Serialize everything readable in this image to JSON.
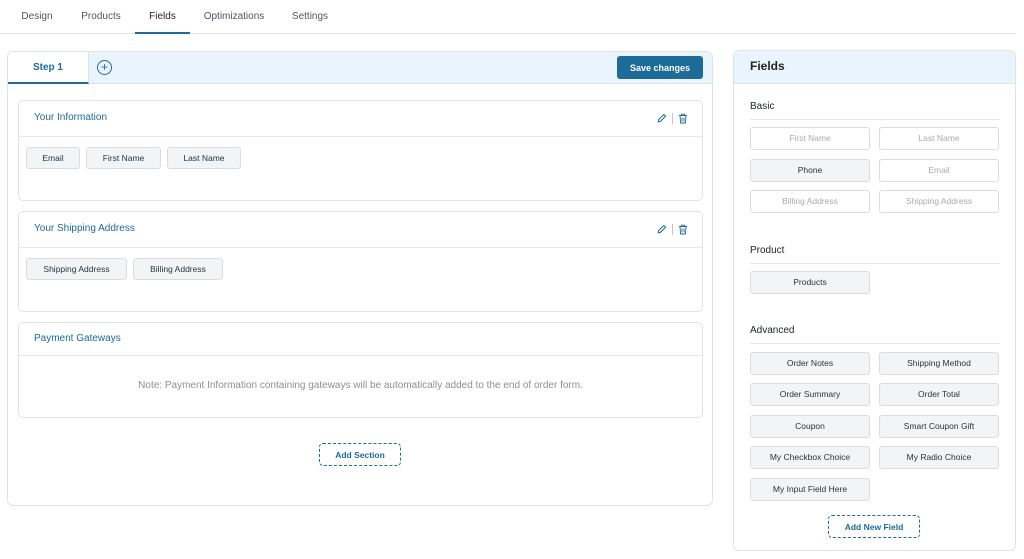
{
  "top_tabs": [
    {
      "label": "Design"
    },
    {
      "label": "Products"
    },
    {
      "label": "Fields",
      "active": true
    },
    {
      "label": "Optimizations"
    },
    {
      "label": "Settings"
    }
  ],
  "steps": {
    "current": "Step 1",
    "add_glyph": "+",
    "save_label": "Save changes"
  },
  "sections": [
    {
      "title": "Your Information",
      "fields": [
        "Email",
        "First Name",
        "Last Name"
      ]
    },
    {
      "title": "Your Shipping Address",
      "fields": [
        "Shipping Address",
        "Billing Address"
      ]
    },
    {
      "title": "Payment Gateways",
      "note": "Note: Payment Information containing gateways will be automatically added to the end of order form."
    }
  ],
  "add_section_label": "Add Section",
  "fields_panel": {
    "title": "Fields",
    "groups": [
      {
        "title": "Basic",
        "items": [
          {
            "label": "First Name",
            "enabled": false
          },
          {
            "label": "Last Name",
            "enabled": false
          },
          {
            "label": "Phone",
            "enabled": true
          },
          {
            "label": "Email",
            "enabled": false
          },
          {
            "label": "Billing Address",
            "enabled": false
          },
          {
            "label": "Shipping Address",
            "enabled": false
          }
        ]
      },
      {
        "title": "Product",
        "items": [
          {
            "label": "Products",
            "enabled": true
          }
        ]
      },
      {
        "title": "Advanced",
        "items": [
          {
            "label": "Order Notes",
            "enabled": true
          },
          {
            "label": "Shipping Method",
            "enabled": true
          },
          {
            "label": "Order Summary",
            "enabled": true
          },
          {
            "label": "Order Total",
            "enabled": true
          },
          {
            "label": "Coupon",
            "enabled": true
          },
          {
            "label": "Smart Coupon Gift",
            "enabled": true
          },
          {
            "label": "My Checkbox Choice",
            "enabled": true
          },
          {
            "label": "My Radio Choice",
            "enabled": true
          },
          {
            "label": "My Input Field Here",
            "enabled": true
          }
        ]
      }
    ],
    "add_field_label": "Add New Field"
  },
  "icons": {
    "edit": "pencil-icon",
    "delete": "trash-icon",
    "add_step": "plus-circle-icon"
  },
  "colors": {
    "accent": "#1c6b98",
    "header_bg": "#eaf4fc"
  }
}
